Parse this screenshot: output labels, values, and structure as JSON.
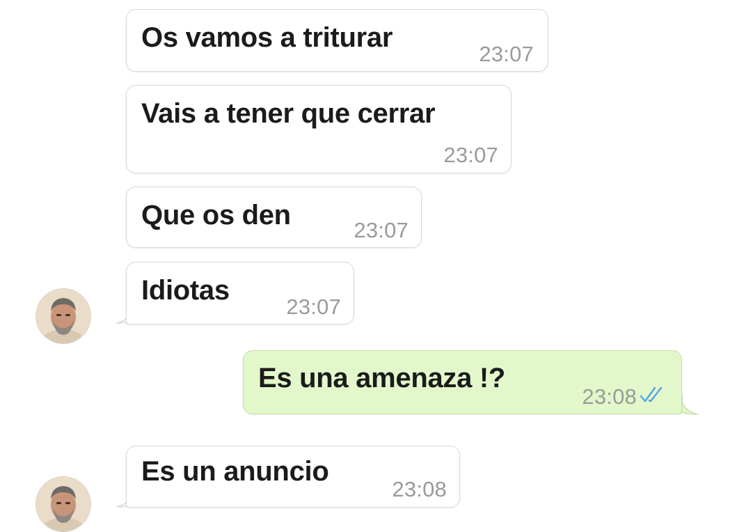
{
  "messages": [
    {
      "direction": "in",
      "text": "Os vamos a triturar",
      "time": "23:07"
    },
    {
      "direction": "in",
      "text": "Vais a tener que cerrar",
      "time": "23:07"
    },
    {
      "direction": "in",
      "text": "Que os den",
      "time": "23:07"
    },
    {
      "direction": "in",
      "text": "Idiotas",
      "time": "23:07"
    },
    {
      "direction": "out",
      "text": "Es una amenaza !?",
      "time": "23:08",
      "status": "read"
    },
    {
      "direction": "in",
      "text": "Es un anuncio",
      "time": "23:08"
    }
  ],
  "icons": {
    "avatar": "contact-avatar",
    "read_receipt": "double-check-icon"
  },
  "colors": {
    "incoming_bubble": "#ffffff",
    "outgoing_bubble": "#e2f8cb",
    "timestamp": "#9a9a9a",
    "read_ticks": "#4fa3e8"
  }
}
